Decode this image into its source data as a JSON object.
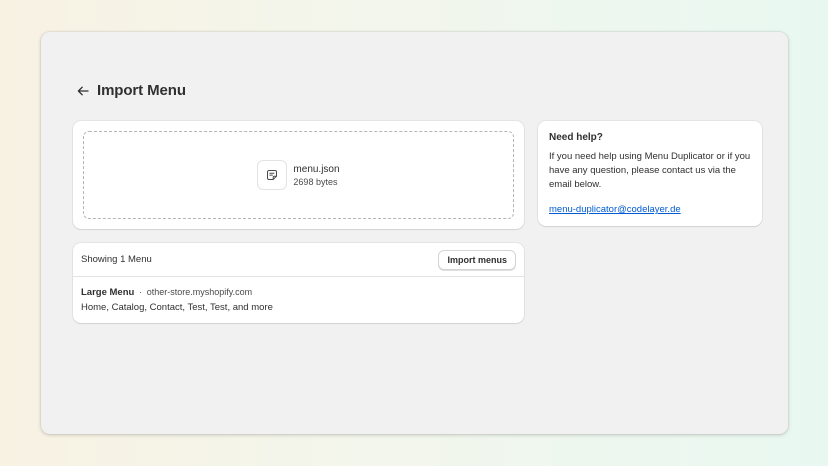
{
  "page": {
    "title": "Import Menu"
  },
  "upload": {
    "file_name": "menu.json",
    "file_size": "2698 bytes",
    "file_icon": "file-icon"
  },
  "help": {
    "title": "Need help?",
    "text": "If you need help using Menu Duplicator or if you have any question, please contact us via the email below.",
    "email": "menu-duplicator@codelayer.de"
  },
  "list": {
    "count_label": "Showing 1 Menu",
    "import_button": "Import menus",
    "items": [
      {
        "name": "Large Menu",
        "separator": "·",
        "store": "other-store.myshopify.com",
        "summary": "Home, Catalog, Contact, Test, Test, and more"
      }
    ]
  },
  "colors": {
    "link": "#005bd3",
    "window_bg": "#f1f1f1",
    "card_bg": "#ffffff",
    "text": "#303030"
  }
}
